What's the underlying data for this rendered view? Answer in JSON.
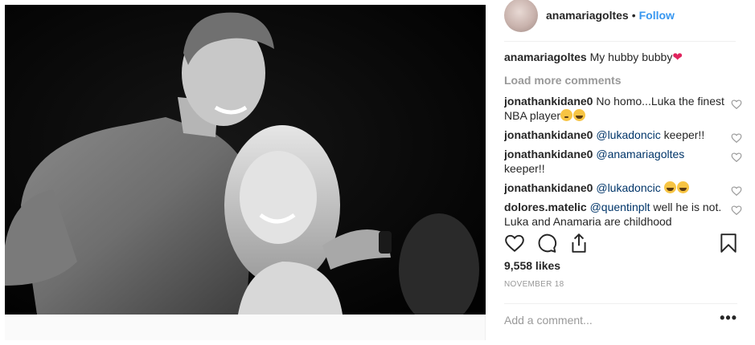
{
  "header": {
    "username": "anamariagoltes",
    "separator": "•",
    "follow_label": "Follow"
  },
  "caption": {
    "username": "anamariagoltes",
    "text": "My hubby bubby",
    "emoji": "❤"
  },
  "load_more_label": "Load more comments",
  "comments": [
    {
      "username": "jonathankidane0",
      "text": "No homo...Luka the finest NBA player",
      "emojis": [
        "shy-face-emoji",
        "laugh-emoji"
      ]
    },
    {
      "username": "jonathankidane0",
      "mention": "@lukadoncic",
      "text": "keeper!!"
    },
    {
      "username": "jonathankidane0",
      "mention": "@anamariagoltes",
      "text": "keeper!!"
    },
    {
      "username": "jonathankidane0",
      "mention": "@lukadoncic",
      "emojis": [
        "laugh-emoji",
        "laugh-emoji"
      ]
    },
    {
      "username": "dolores.matelic",
      "mention": "@quentinplt",
      "text": "well he is not. Luka and Anamaria are childhood"
    }
  ],
  "likes_text": "9,558 likes",
  "date_text": "NOVEMBER 18",
  "add_comment": {
    "placeholder": "Add a comment..."
  },
  "more_label": "•••",
  "colors": {
    "link": "#3897f0",
    "muted": "#999999",
    "mention": "#003569",
    "heart": "#e0245e"
  },
  "icons": [
    "heart-icon",
    "comment-icon",
    "share-icon",
    "bookmark-icon"
  ]
}
